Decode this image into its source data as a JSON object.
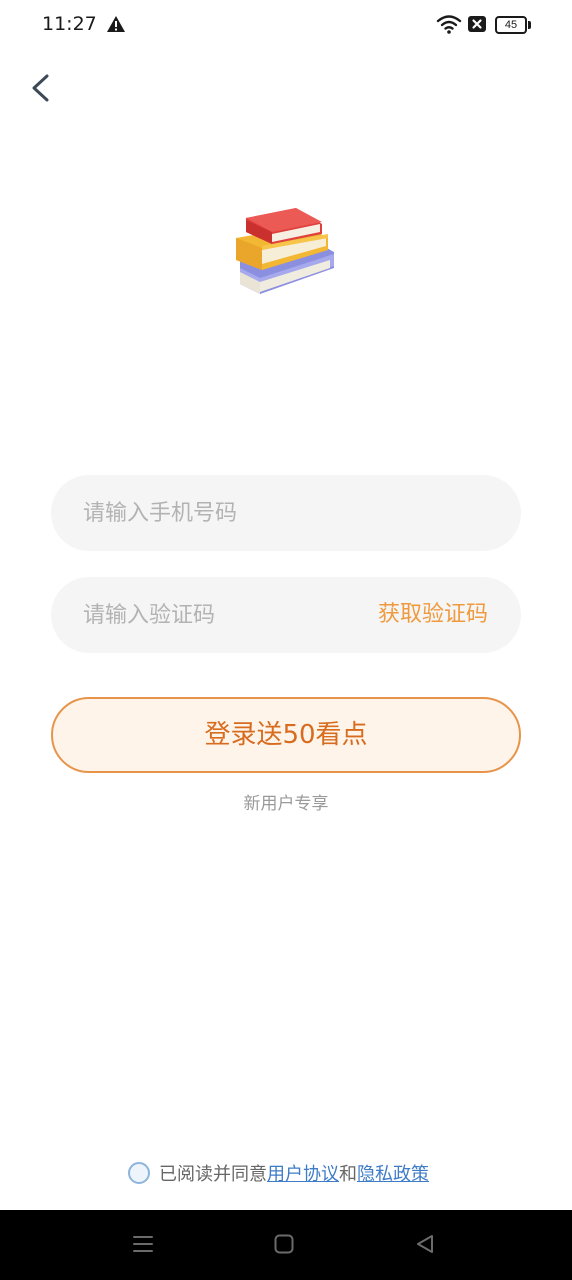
{
  "status_bar": {
    "time": "11:27",
    "battery": "45",
    "icons": [
      "warning-icon",
      "wifi-icon",
      "x-notification-icon",
      "battery-icon"
    ]
  },
  "header": {
    "back_icon": "chevron-left-icon"
  },
  "logo": {
    "icon": "books-stack-icon"
  },
  "form": {
    "phone_placeholder": "请输入手机号码",
    "phone_value": "",
    "code_placeholder": "请输入验证码",
    "code_value": "",
    "get_code_label": "获取验证码",
    "login_label": "登录送50看点",
    "login_subtext": "新用户专享"
  },
  "agreement": {
    "prefix": "已阅读并同意",
    "user_agreement": "用户协议",
    "conjunction": "和",
    "privacy_policy": "隐私政策",
    "checked": false
  },
  "nav_bar": {
    "icons": [
      "menu-icon",
      "home-icon",
      "back-triangle-icon"
    ]
  },
  "colors": {
    "accent": "#f09a3e",
    "login_text": "#d76c1f",
    "login_border": "#e7944a",
    "login_bg": "#fff4ea",
    "input_bg": "#f5f5f5",
    "link": "#3f7cc7"
  }
}
